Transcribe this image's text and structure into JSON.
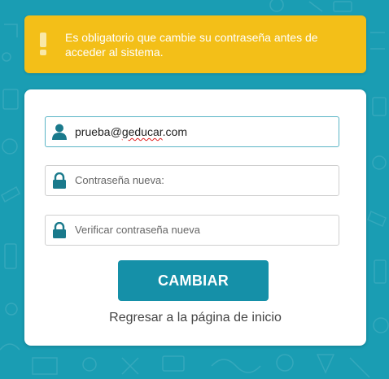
{
  "alert": {
    "message": "Es obligatorio que cambie su contraseña antes de acceder al sistema."
  },
  "form": {
    "email": {
      "value_prefix": "prueba@",
      "value_misspelled": "geducar",
      "value_suffix": ".com",
      "icon": "user-icon"
    },
    "new_password": {
      "placeholder": "Contraseña nueva:",
      "icon": "lock-icon"
    },
    "verify_password": {
      "placeholder": "Verificar contraseña nueva",
      "icon": "lock-icon"
    },
    "submit_label": "CAMBIAR",
    "back_link": "Regresar a la página de inicio"
  },
  "colors": {
    "background": "#1a9db3",
    "alert": "#f3bf18",
    "button": "#1590a8",
    "icon": "#1a7a8c"
  }
}
